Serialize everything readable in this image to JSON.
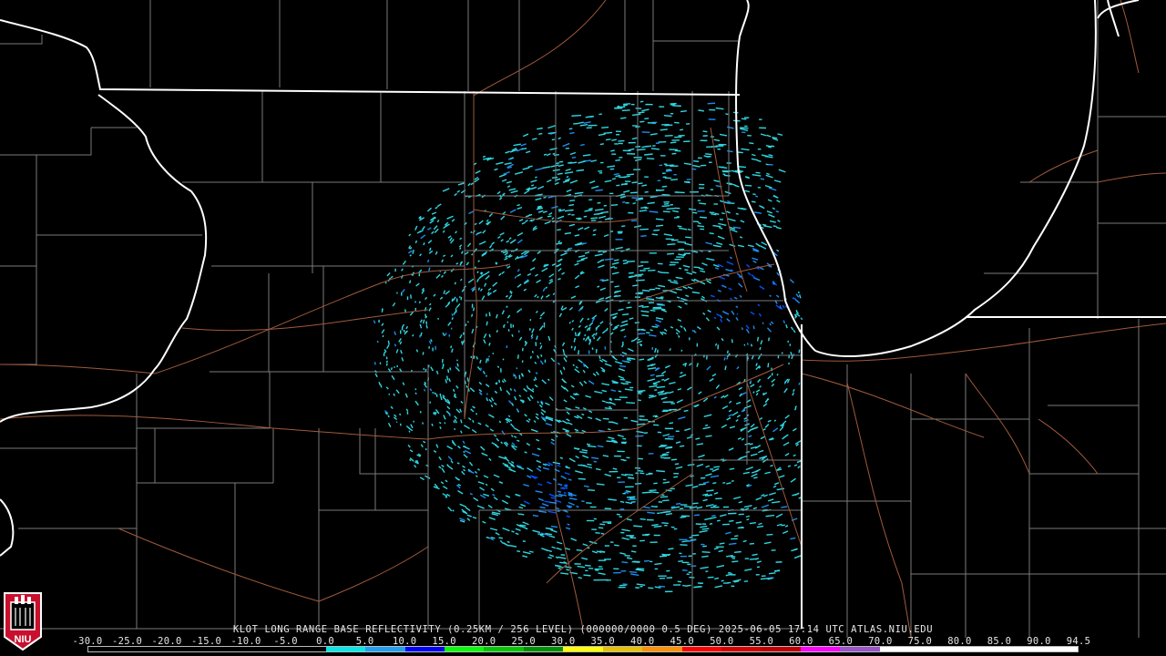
{
  "product_title": "KLOT LONG RANGE BASE REFLECTIVITY (0.25KM / 256 LEVEL) (000000/0000 0.5 DEG) 2025-06-05 17:14 UTC  ATLAS.NIU.EDU",
  "logo_text": "NIU",
  "colorbar": {
    "labels": [
      "-30.0",
      "-25.0",
      "-20.0",
      "-15.0",
      "-10.0",
      "-5.0",
      "0.0",
      "5.0",
      "10.0",
      "15.0",
      "20.0",
      "25.0",
      "30.0",
      "35.0",
      "40.0",
      "45.0",
      "50.0",
      "55.0",
      "60.0",
      "65.0",
      "70.0",
      "75.0",
      "80.0",
      "85.0",
      "90.0",
      "94.5"
    ],
    "colors": [
      "#000000",
      "#000000",
      "#000000",
      "#000000",
      "#000000",
      "#000000",
      "#00e8e8",
      "#1fa0f0",
      "#0000f6",
      "#00ff00",
      "#00c800",
      "#009000",
      "#ffff00",
      "#e7c000",
      "#ff9000",
      "#ff0000",
      "#d60000",
      "#c00000",
      "#ff00ff",
      "#9955c9",
      "#ffffff",
      "#ffffff",
      "#ffffff",
      "#ffffff",
      "#ffffff"
    ]
  },
  "map_colors": {
    "background": "#000000",
    "state_lines": "#ffffff",
    "county_lines": "#7a7a7a",
    "highways": "#a05a3c",
    "echo_light": "#2fd6e0",
    "echo_mid": "#1e8cf0",
    "echo_heavy": "#0050ff"
  }
}
